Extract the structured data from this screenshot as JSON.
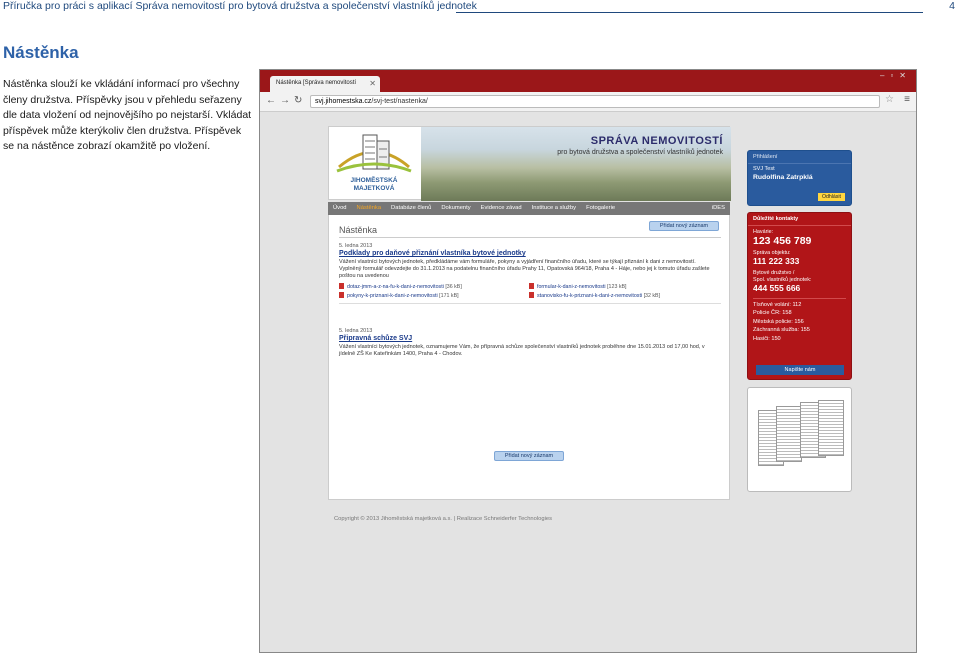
{
  "document": {
    "header_title": "Příručka pro práci s aplikací Správa nemovitostí pro bytová družstva a společenství vlastníků jednotek",
    "page_number": "4",
    "section_heading": "Nástěnka",
    "body_text": "Nástěnka slouží ke vkládání informací pro všechny členy družstva. Příspěvky jsou v přehledu seřazeny dle data vložení od nejnovějšího po nejstarší. Vkládat příspěvek může kterýkoliv člen družstva. Příspěvek se na nástěnce zobrazí okamžitě po vložení."
  },
  "browser": {
    "tab_title": "Nástěnka [Správa nemovitostí",
    "url_host": "svj.jihomestska.cz",
    "url_path": "/svj-test/nastenka/"
  },
  "site": {
    "logo_text": "JIHOMĚSTSKÁ MAJETKOVÁ",
    "brand_title": "SPRÁVA NEMOVITOSTÍ",
    "brand_subtitle": "pro bytová družstva a společenství vlastníků jednotek",
    "nav": [
      "Úvod",
      "Nástěnka",
      "Databáze členů",
      "Dokumenty",
      "Evidence závad",
      "Instituce a služby",
      "Fotogalerie"
    ],
    "nav_right": "iDES",
    "page_title": "Nástěnka",
    "add_button": "Přidat nový záznam",
    "posts": [
      {
        "date": "5. ledna 2013",
        "title": "Podklady pro daňové přiznání vlastníka bytové jednotky",
        "body": "Vážení vlastníci bytových jednotek, předkládáme vám formuláře, pokyny a vyjádření finančního úřadu, které se týkají přiznání k dani z nemovitostí. Vyplněný formulář odevzdejte do 31.1.2013 na podatelnu finančního úřadu Prahy 11, Opatovská 964/18, Praha 4 - Háje, nebo jej k tomuto úřadu zašlete poštou na uvedenou",
        "attachments": [
          {
            "name": "dotaz-jmm-a-z-na-fu-k-dani-z-nemovitosti",
            "size": "[36 kB]"
          },
          {
            "name": "formular-k-dani-z-nemovitosti",
            "size": "[123 kB]"
          },
          {
            "name": "pokyny-k-priznani-k-dani-z-nemovitosti",
            "size": "[171 kB]"
          },
          {
            "name": "stanovisko-fu-k-priznani-k-dani-z-nemovitosti",
            "size": "[32 kB]"
          }
        ]
      },
      {
        "date": "5. ledna 2013",
        "title": "Připravná schůze SVJ",
        "body": "Vážení vlastníci bytových jednotek, oznamujeme Vám, že přípravná schůze společenství vlastníků jednotek proběhne dne 15.01.2013 od 17,00 hod, v jídelně ZŠ Ke Kateřinkám 1400, Praha 4 - Chodov."
      }
    ],
    "login": {
      "heading": "Přihlášení",
      "org": "SVJ Test",
      "user": "Rudolfina Zatrpklá",
      "logout": "Odhlásit"
    },
    "contacts": {
      "heading": "Důležité kontakty",
      "emergency_label": "Havárie:",
      "emergency_phone": "123 456 789",
      "manager_label": "Správa objektu:",
      "manager_phone": "111 222 333",
      "coop_label_1": "Bytové družstvo /",
      "coop_label_2": "Spol. vlastníků jednotek:",
      "coop_phone": "444 555 666",
      "lines": [
        "Tísňové volání: 112",
        "Policie ČR: 158",
        "Městská policie: 156",
        "Záchranná služba: 155",
        "Hasiči: 150"
      ],
      "write_us": "Napište nám"
    },
    "footer": "Copyright © 2013 Jihoměstská majetková a.s.   |   Realizace Schneiderfer Technologies"
  }
}
